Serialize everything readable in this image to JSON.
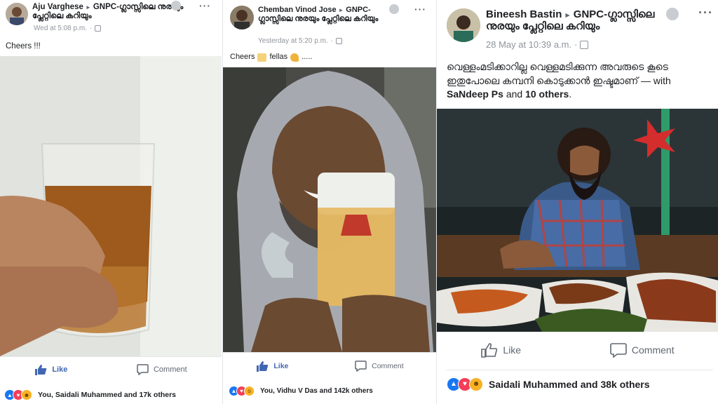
{
  "posts": [
    {
      "author": "Aju Varghese",
      "group": "GNPC-ഗ്ലാസ്സിലെ നുരയും പ്ലേറ്റിലെ കറിയും",
      "time": "Wed at 5:08 p.m.",
      "caption": "Cheers !!!",
      "actions": {
        "like": "Like",
        "comment": "Comment"
      },
      "reactions_text": "You, Saidali Muhammed and 17k others"
    },
    {
      "author": "Chemban Vinod Jose",
      "group": "GNPC-ഗ്ലാസ്സിലെ നുരയും പ്ലേറ്റിലെ കറിയും",
      "time": "Yesterday at 5:20 p.m.",
      "caption_a": "Cheers",
      "caption_b": "fellas",
      "caption_c": ".....",
      "actions": {
        "like": "Like",
        "comment": "Comment"
      },
      "reactions_text": "You, Vidhu V Das and 142k others"
    },
    {
      "author": "Bineesh Bastin",
      "group": "GNPC-ഗ്ലാസ്സിലെ നുരയും പ്ലേറ്റിലെ കറിയും",
      "time": "28 May at 10:39 a.m.",
      "caption_line": "വെള്ളംമടിക്കാറില്ല വെള്ളമടിക്കുന്ന അവരുടെ കൂടെ ഇതുപോലെ കമ്പനി കൊടുക്കാൻ ഇഷ്ടമാണ് — with",
      "tag_person": "SaNdeep Ps",
      "tag_and": "and",
      "tag_others": "10 others",
      "tag_end": ".",
      "actions": {
        "like": "Like",
        "comment": "Comment"
      },
      "reactions_text": "Saidali Muhammed and 38k others"
    }
  ],
  "colors": {
    "brand_blue": "#4267b2",
    "like_blue": "#1877f2",
    "love_red": "#f33e58",
    "haha_yellow": "#f7b125",
    "meta_gray": "#90949c"
  },
  "icons": [
    "more-icon",
    "globe-icon",
    "thumbs-up-icon",
    "comment-icon",
    "like-reaction-icon",
    "love-reaction-icon",
    "haha-reaction-icon",
    "wow-reaction-icon"
  ]
}
